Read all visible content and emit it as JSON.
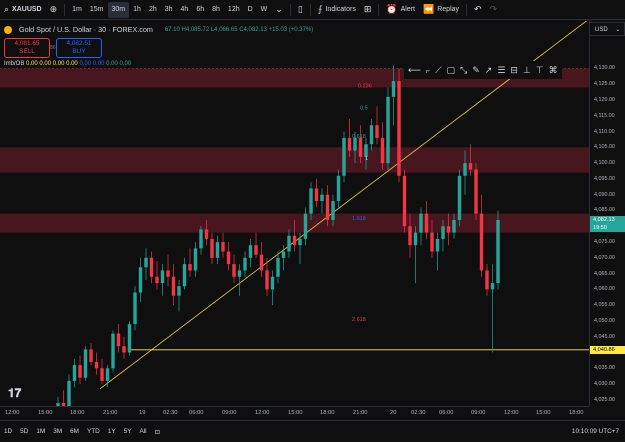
{
  "toolbar": {
    "symbol": "XAUUSD",
    "intervals": [
      "1m",
      "15m",
      "30m",
      "1h",
      "2h",
      "3h",
      "4h",
      "6h",
      "8h",
      "12h",
      "D",
      "W"
    ],
    "active_interval": "30m",
    "indicators_label": "Indicators",
    "alert_label": "Alert",
    "replay_label": "Replay"
  },
  "legend": {
    "title": "Gold Spot / U.S. Dollar · 30 · FOREX.com",
    "ohlc": "67.10 H4,085.72 L4,066.65 C4,082.13 +15.03 (+0.37%)",
    "sell_price": "4,081.65",
    "sell_label": "SELL",
    "buy_price": "4,082.51",
    "buy_label": "BUY",
    "spread": "86",
    "indicator_name": "Imb/OB",
    "indicator_values": [
      "0.00",
      "0.00",
      "0.00",
      "0.00",
      "0.00",
      "0.00",
      "0.00",
      "0.00"
    ]
  },
  "price_axis": {
    "currency": "USD",
    "ticks": [
      "4,130.00",
      "4,125.00",
      "4,120.00",
      "4,115.00",
      "4,110.00",
      "4,105.00",
      "4,100.00",
      "4,095.00",
      "4,090.00",
      "4,085.00",
      "4,075.00",
      "4,070.00",
      "4,065.00",
      "4,060.00",
      "4,055.00",
      "4,050.00",
      "4,045.00",
      "4,035.00",
      "4,030.00",
      "4,025.00"
    ],
    "current_price": "4,082.13",
    "countdown": "19:50",
    "hline_price": "4,040.86"
  },
  "fib_labels": [
    "0.236",
    "0.5",
    "0.618",
    "1",
    "1.618",
    "2.618"
  ],
  "time_axis": [
    "12:00",
    "15:00",
    "18:00",
    "21:00",
    "19",
    "02:30",
    "06:00",
    "09:00",
    "12:00",
    "15:00",
    "18:00",
    "21:00",
    "20",
    "02:30",
    "06:00",
    "09:00",
    "12:00",
    "15:00",
    "18:00"
  ],
  "bottom": {
    "ranges": [
      "1D",
      "5D",
      "1M",
      "3M",
      "6M",
      "YTD",
      "1Y",
      "5Y",
      "All"
    ],
    "clock": "10:10:09 UTC+7"
  },
  "colors": {
    "up": "#26a69a",
    "down": "#f23645",
    "zone": "#5c1a24",
    "trendline": "#d4b94a",
    "hline": "#ffeb3b"
  },
  "chart_data": {
    "type": "candlestick",
    "title": "Gold Spot / U.S. Dollar · 30 · FOREX.com",
    "ylim": [
      4024,
      4133
    ],
    "x_labels": [
      "12:00",
      "15:00",
      "18:00",
      "21:00",
      "19",
      "02:30",
      "06:00",
      "09:00",
      "12:00",
      "15:00",
      "18:00",
      "21:00",
      "20",
      "02:30",
      "06:00",
      "09:00",
      "12:00",
      "15:00",
      "18:00"
    ],
    "candles": [
      [
        4021,
        4026,
        4018,
        4024
      ],
      [
        4024,
        4028,
        4020,
        4022
      ],
      [
        4022,
        4033,
        4021,
        4031
      ],
      [
        4031,
        4038,
        4029,
        4036
      ],
      [
        4036,
        4039,
        4030,
        4032
      ],
      [
        4032,
        4042,
        4031,
        4041
      ],
      [
        4041,
        4043,
        4036,
        4037
      ],
      [
        4037,
        4040,
        4033,
        4035
      ],
      [
        4035,
        4038,
        4030,
        4031
      ],
      [
        4031,
        4036,
        4029,
        4035
      ],
      [
        4035,
        4047,
        4034,
        4046
      ],
      [
        4046,
        4049,
        4040,
        4042
      ],
      [
        4042,
        4045,
        4038,
        4040
      ],
      [
        4040,
        4050,
        4039,
        4049
      ],
      [
        4049,
        4061,
        4047,
        4059
      ],
      [
        4059,
        4070,
        4056,
        4067
      ],
      [
        4067,
        4073,
        4063,
        4070
      ],
      [
        4070,
        4072,
        4062,
        4064
      ],
      [
        4064,
        4069,
        4060,
        4062
      ],
      [
        4062,
        4068,
        4058,
        4066
      ],
      [
        4066,
        4071,
        4061,
        4064
      ],
      [
        4064,
        4068,
        4055,
        4058
      ],
      [
        4058,
        4063,
        4053,
        4061
      ],
      [
        4061,
        4070,
        4060,
        4068
      ],
      [
        4068,
        4073,
        4064,
        4066
      ],
      [
        4066,
        4075,
        4064,
        4073
      ],
      [
        4073,
        4080,
        4071,
        4079
      ],
      [
        4079,
        4082,
        4074,
        4076
      ],
      [
        4076,
        4078,
        4068,
        4070
      ],
      [
        4070,
        4077,
        4068,
        4075
      ],
      [
        4075,
        4078,
        4070,
        4072
      ],
      [
        4072,
        4075,
        4066,
        4068
      ],
      [
        4068,
        4071,
        4062,
        4064
      ],
      [
        4064,
        4068,
        4058,
        4066
      ],
      [
        4066,
        4072,
        4064,
        4070
      ],
      [
        4070,
        4076,
        4067,
        4074
      ],
      [
        4074,
        4078,
        4070,
        4071
      ],
      [
        4071,
        4075,
        4064,
        4066
      ],
      [
        4066,
        4070,
        4058,
        4060
      ],
      [
        4060,
        4066,
        4055,
        4064
      ],
      [
        4064,
        4072,
        4062,
        4070
      ],
      [
        4070,
        4074,
        4066,
        4072
      ],
      [
        4072,
        4079,
        4070,
        4077
      ],
      [
        4077,
        4082,
        4072,
        4074
      ],
      [
        4074,
        4078,
        4068,
        4076
      ],
      [
        4076,
        4086,
        4074,
        4084
      ],
      [
        4084,
        4094,
        4082,
        4092
      ],
      [
        4092,
        4095,
        4086,
        4088
      ],
      [
        4088,
        4092,
        4084,
        4090
      ],
      [
        4090,
        4093,
        4080,
        4082
      ],
      [
        4082,
        4090,
        4080,
        4088
      ],
      [
        4088,
        4098,
        4086,
        4096
      ],
      [
        4096,
        4110,
        4094,
        4108
      ],
      [
        4108,
        4114,
        4102,
        4104
      ],
      [
        4104,
        4110,
        4100,
        4108
      ],
      [
        4108,
        4112,
        4100,
        4102
      ],
      [
        4102,
        4108,
        4098,
        4106
      ],
      [
        4106,
        4114,
        4104,
        4112
      ],
      [
        4112,
        4118,
        4106,
        4108
      ],
      [
        4108,
        4113,
        4098,
        4100
      ],
      [
        4100,
        4124,
        4098,
        4121
      ],
      [
        4121,
        4131,
        4112,
        4126
      ],
      [
        4126,
        4130,
        4094,
        4096
      ],
      [
        4096,
        4098,
        4078,
        4080
      ],
      [
        4080,
        4084,
        4070,
        4074
      ],
      [
        4074,
        4080,
        4062,
        4078
      ],
      [
        4078,
        4086,
        4074,
        4084
      ],
      [
        4084,
        4088,
        4076,
        4078
      ],
      [
        4078,
        4082,
        4070,
        4072
      ],
      [
        4072,
        4078,
        4066,
        4076
      ],
      [
        4076,
        4082,
        4072,
        4080
      ],
      [
        4080,
        4084,
        4074,
        4078
      ],
      [
        4078,
        4084,
        4076,
        4082
      ],
      [
        4082,
        4098,
        4080,
        4096
      ],
      [
        4096,
        4104,
        4090,
        4100
      ],
      [
        4100,
        4106,
        4096,
        4098
      ],
      [
        4098,
        4100,
        4082,
        4084
      ],
      [
        4084,
        4090,
        4064,
        4066
      ],
      [
        4066,
        4068,
        4058,
        4060
      ],
      [
        4060,
        4068,
        4040,
        4062
      ],
      [
        4062,
        4085,
        4060,
        4082
      ]
    ],
    "hline": 4040.86,
    "zones": [
      [
        4124,
        4130
      ],
      [
        4097,
        4105
      ],
      [
        4078,
        4084
      ]
    ],
    "trendline": [
      [
        4028.5,
        0
      ],
      [
        4133,
        1
      ]
    ]
  }
}
